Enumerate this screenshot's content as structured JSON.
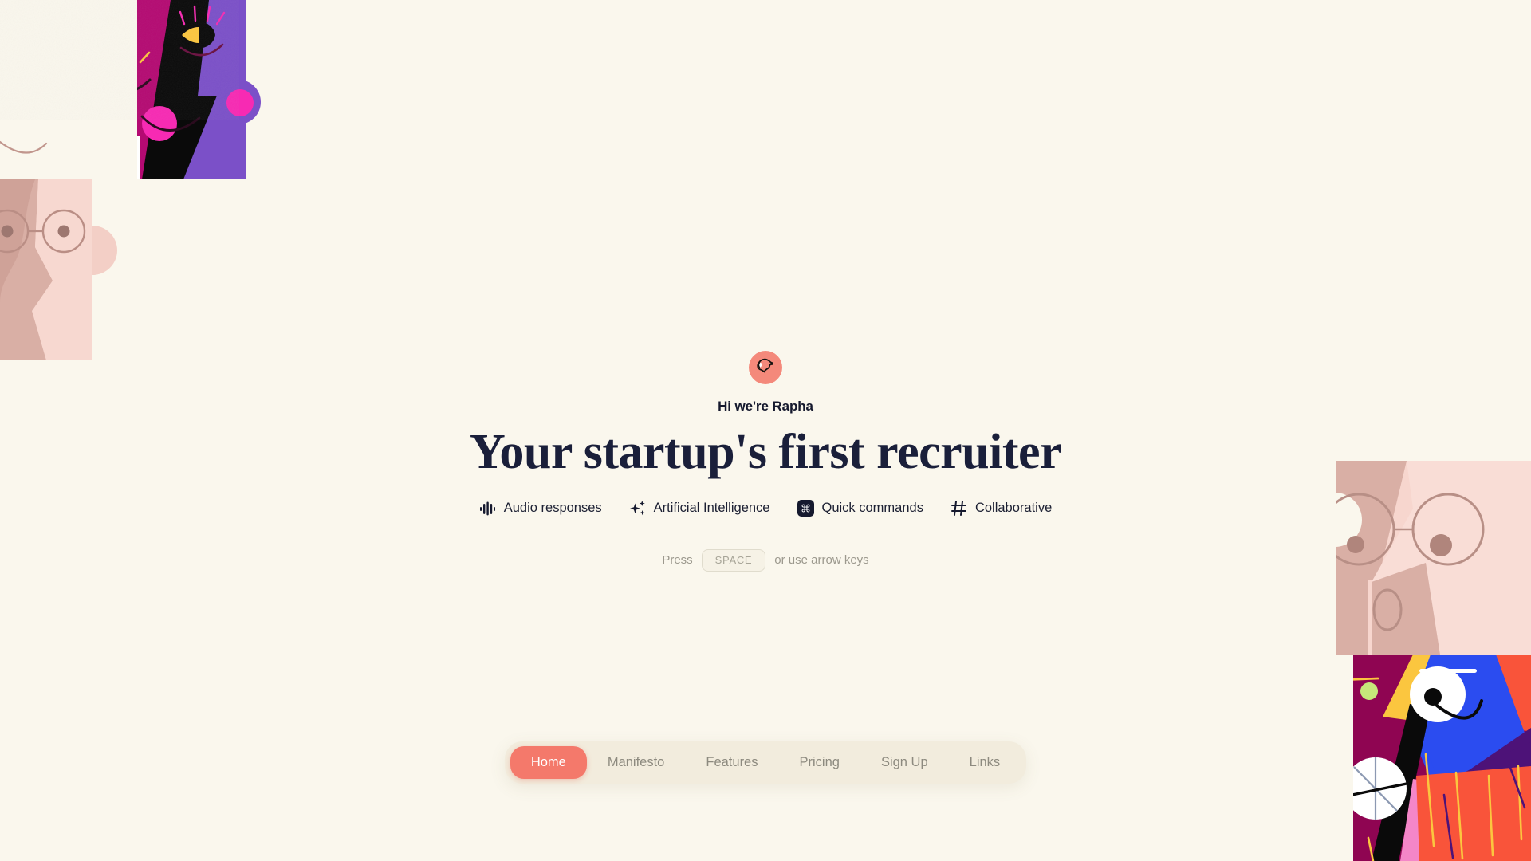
{
  "page": {
    "background_color": "#faf7ed",
    "accent_color": "#f4796b",
    "text_color": "#1a1f3a"
  },
  "hero": {
    "logo_icon": "dog-head-icon",
    "logo_badge_color": "#f4897b",
    "eyebrow": "Hi we're Rapha",
    "headline": "Your startup's first recruiter",
    "features": [
      {
        "icon": "audio-waveform-icon",
        "label": "Audio responses"
      },
      {
        "icon": "sparkles-icon",
        "label": "Artificial Intelligence"
      },
      {
        "icon": "command-key-icon",
        "label": "Quick commands"
      },
      {
        "icon": "hash-icon",
        "label": "Collaborative"
      }
    ],
    "hint": {
      "prefix": "Press",
      "key": "SPACE",
      "suffix": "or use arrow keys"
    }
  },
  "nav": {
    "items": [
      {
        "label": "Home",
        "active": true
      },
      {
        "label": "Manifesto",
        "active": false
      },
      {
        "label": "Features",
        "active": false
      },
      {
        "label": "Pricing",
        "active": false
      },
      {
        "label": "Sign Up",
        "active": false
      },
      {
        "label": "Links",
        "active": false
      }
    ]
  },
  "artwork": {
    "top_left": "abstract-face-collage-magenta-purple",
    "bottom_left": "puzzle-piece-face-blush",
    "right_top": "face-with-round-glasses-blush",
    "right_bottom": "abstract-geometric-face-blue-orange"
  }
}
